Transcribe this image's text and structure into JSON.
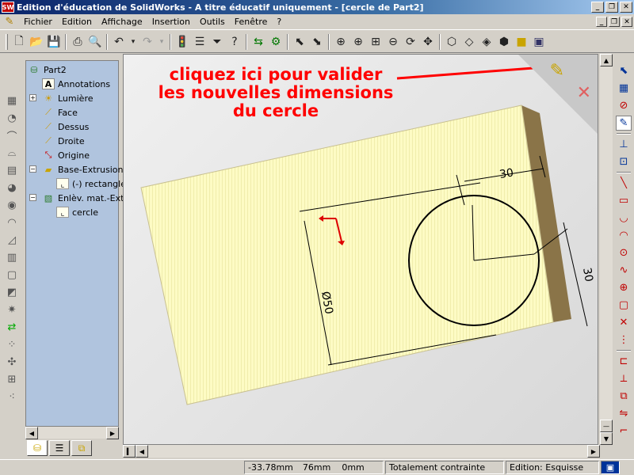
{
  "window": {
    "title": "Edition d'éducation de SolidWorks - A titre éducatif uniquement - [cercle de Part2]",
    "logo_text": "SW"
  },
  "menu": {
    "items": [
      "Fichier",
      "Edition",
      "Affichage",
      "Insertion",
      "Outils",
      "Fenêtre",
      "?"
    ]
  },
  "tree": {
    "root": "Part2",
    "items": [
      {
        "label": "Annotations",
        "icon": "annotations-icon"
      },
      {
        "label": "Lumière",
        "icon": "light-icon"
      },
      {
        "label": "Face",
        "icon": "plane-icon"
      },
      {
        "label": "Dessus",
        "icon": "plane-icon"
      },
      {
        "label": "Droite",
        "icon": "plane-icon"
      },
      {
        "label": "Origine",
        "icon": "origin-icon"
      },
      {
        "label": "Base-Extrusion",
        "icon": "extrude-icon"
      },
      {
        "label": "(-) rectangle",
        "icon": "sketch-icon"
      },
      {
        "label": "Enlèv. mat.-Ext",
        "icon": "cut-icon"
      },
      {
        "label": "cercle",
        "icon": "sketch-icon"
      }
    ]
  },
  "viewport": {
    "annotation_lines": [
      "cliquez ici pour valider",
      "les nouvelles dimensions",
      "du cercle"
    ],
    "dim_top": "30",
    "dim_right": "30",
    "dim_diameter": "Ø50",
    "annotation_color": "#ff0000",
    "part_color": "#fdfbc4"
  },
  "status": {
    "x": "-33.78mm",
    "y": "76mm",
    "z": "0mm",
    "state": "Totalement contrainte",
    "mode": "Edition: Esquisse"
  }
}
